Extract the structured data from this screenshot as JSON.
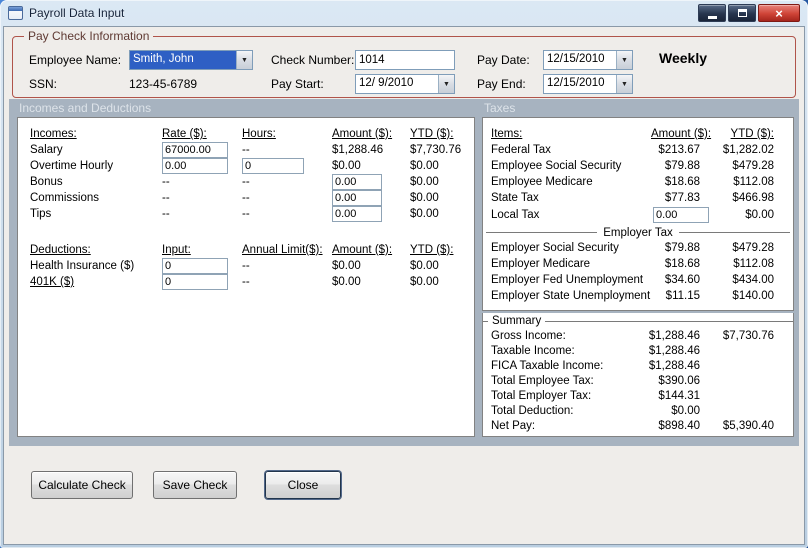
{
  "window": {
    "title": "Payroll Data Input"
  },
  "icons": {
    "close_glyph": "×",
    "dropdown_glyph": "▼"
  },
  "paycheck": {
    "group_title": "Pay Check Information",
    "employee_name": {
      "label": "Employee Name:",
      "value": "Smith, John"
    },
    "ssn": {
      "label": "SSN:",
      "value": "123-45-6789"
    },
    "check_number": {
      "label": "Check Number:",
      "value": "1014"
    },
    "pay_start": {
      "label": "Pay Start:",
      "value": "12/ 9/2010"
    },
    "pay_date": {
      "label": "Pay Date:",
      "value": "12/15/2010"
    },
    "pay_end": {
      "label": "Pay End:",
      "value": "12/15/2010"
    },
    "frequency": "Weekly"
  },
  "sections": {
    "incomes_and_deductions": "Incomes and Deductions",
    "taxes": "Taxes"
  },
  "incomes": {
    "headers": [
      "Incomes:",
      "Rate ($):",
      "Hours:",
      "Amount ($):",
      "YTD ($):"
    ],
    "rows": [
      {
        "label": "Salary",
        "rate": "67000.00",
        "hours": "--",
        "amount": "$1,288.46",
        "ytd": "$7,730.76"
      },
      {
        "label": "Overtime Hourly",
        "rate": "0.00",
        "hours": "0",
        "amount": "$0.00",
        "ytd": "$0.00"
      },
      {
        "label": "Bonus",
        "rate": "--",
        "hours": "--",
        "amount": "0.00",
        "ytd": "$0.00"
      },
      {
        "label": "Commissions",
        "rate": "--",
        "hours": "--",
        "amount": "0.00",
        "ytd": "$0.00"
      },
      {
        "label": "Tips",
        "rate": "--",
        "hours": "--",
        "amount": "0.00",
        "ytd": "$0.00"
      }
    ]
  },
  "deductions": {
    "headers": [
      "Deductions:",
      "Input:",
      "Annual Limit($):",
      "Amount ($):",
      "YTD ($):"
    ],
    "rows": [
      {
        "label": "Health Insurance ($)",
        "input": "0",
        "limit": "--",
        "amount": "$0.00",
        "ytd": "$0.00"
      },
      {
        "label": "401K ($)",
        "input": "0",
        "limit": "--",
        "amount": "$0.00",
        "ytd": "$0.00"
      }
    ]
  },
  "taxes": {
    "headers": [
      "Items:",
      "Amount ($):",
      "YTD ($):"
    ],
    "employee_rows": [
      {
        "label": "Federal Tax",
        "amount": "$213.67",
        "ytd": "$1,282.02"
      },
      {
        "label": "Employee Social Security",
        "amount": "$79.88",
        "ytd": "$479.28"
      },
      {
        "label": "Employee Medicare",
        "amount": "$18.68",
        "ytd": "$112.08"
      },
      {
        "label": "State Tax",
        "amount": "$77.83",
        "ytd": "$466.98"
      },
      {
        "label": "Local Tax",
        "amount": "0.00",
        "ytd": "$0.00"
      }
    ],
    "employer_header": "Employer Tax",
    "employer_rows": [
      {
        "label": "Employer Social Security",
        "amount": "$79.88",
        "ytd": "$479.28"
      },
      {
        "label": "Employer Medicare",
        "amount": "$18.68",
        "ytd": "$112.08"
      },
      {
        "label": "Employer Fed Unemployment",
        "amount": "$34.60",
        "ytd": "$434.00"
      },
      {
        "label": "Employer State Unemployment",
        "amount": "$11.15",
        "ytd": "$140.00"
      }
    ]
  },
  "summary": {
    "group_title": "Summary",
    "rows": [
      {
        "label": "Gross Income:",
        "amount": "$1,288.46",
        "ytd": "$7,730.76"
      },
      {
        "label": "Taxable Income:",
        "amount": "$1,288.46",
        "ytd": ""
      },
      {
        "label": "FICA Taxable Income:",
        "amount": "$1,288.46",
        "ytd": ""
      },
      {
        "label": "Total Employee Tax:",
        "amount": "$390.06",
        "ytd": ""
      },
      {
        "label": "Total Employer Tax:",
        "amount": "$144.31",
        "ytd": ""
      },
      {
        "label": "Total Deduction:",
        "amount": "$0.00",
        "ytd": ""
      },
      {
        "label": "Net Pay:",
        "amount": "$898.40",
        "ytd": "$5,390.40"
      }
    ]
  },
  "buttons": {
    "calculate": "Calculate Check",
    "save": "Save Check",
    "close": "Close"
  }
}
